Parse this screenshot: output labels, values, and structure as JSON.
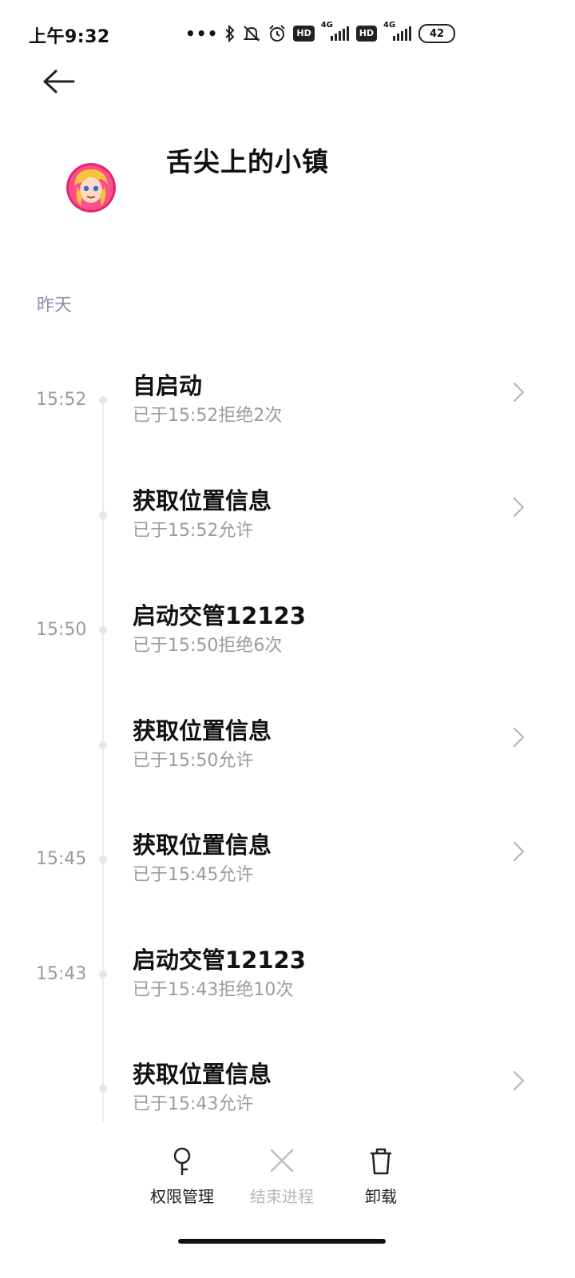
{
  "status_bar": {
    "time": "上午9:32",
    "network1": "4G",
    "network2": "4G",
    "hd1": "HD",
    "hd2": "HD",
    "battery": "42",
    "icons": [
      "more-dots-icon",
      "bluetooth-icon",
      "mute-icon",
      "alarm-icon",
      "hd-icon",
      "signal-icon",
      "hd-icon",
      "signal-icon",
      "battery-icon"
    ]
  },
  "header": {
    "back_icon": "back-arrow-icon",
    "app_name": "舌尖上的小镇"
  },
  "section": {
    "date": "昨天"
  },
  "entries": [
    {
      "time": "15:52",
      "title": "自启动",
      "sub": "已于15:52拒绝2次",
      "has_chevron": true
    },
    {
      "time": "",
      "title": "获取位置信息",
      "sub": "已于15:52允许",
      "has_chevron": true
    },
    {
      "time": "15:50",
      "title": "启动交管12123",
      "sub": "已于15:50拒绝6次",
      "has_chevron": false
    },
    {
      "time": "",
      "title": "获取位置信息",
      "sub": "已于15:50允许",
      "has_chevron": true
    },
    {
      "time": "15:45",
      "title": "获取位置信息",
      "sub": "已于15:45允许",
      "has_chevron": true
    },
    {
      "time": "15:43",
      "title": "启动交管12123",
      "sub": "已于15:43拒绝10次",
      "has_chevron": false
    },
    {
      "time": "",
      "title": "获取位置信息",
      "sub": "已于15:43允许",
      "has_chevron": true
    }
  ],
  "bottom_bar": {
    "permissions": "权限管理",
    "end_process": "结束进程",
    "uninstall": "卸载"
  },
  "colors": {
    "section_date": "#8a8fa8",
    "subtext": "#9b9b9b",
    "disabled": "#b8b8b8"
  }
}
